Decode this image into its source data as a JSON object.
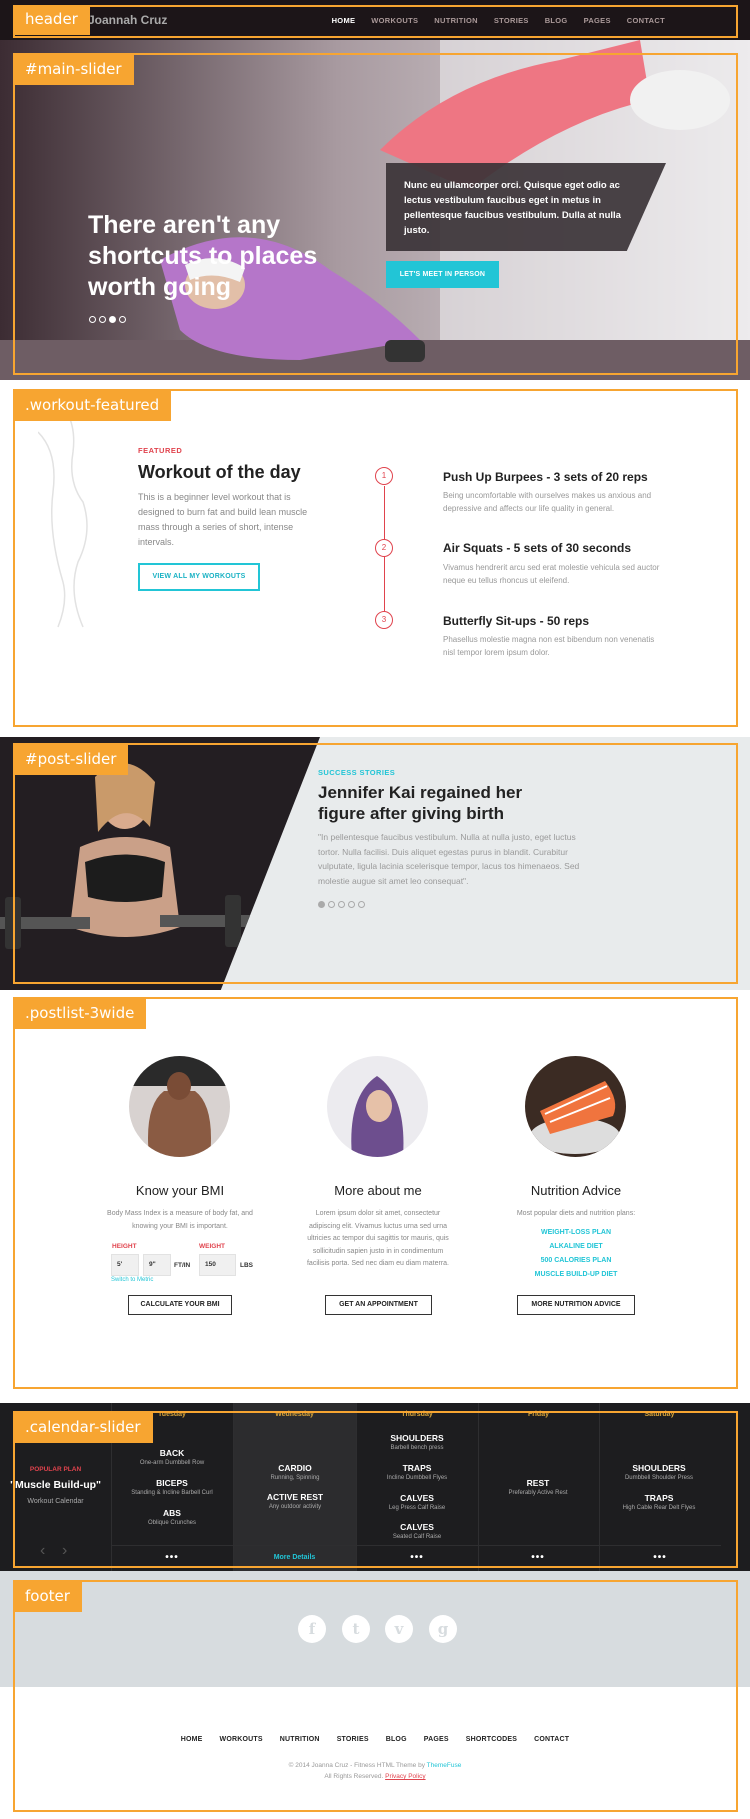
{
  "colors": {
    "accent": "#22c5d6",
    "red": "#e0434d",
    "annotation": "#f7a531",
    "dark": "#1c1518"
  },
  "annotations": {
    "header": "header",
    "main_slider": "#main-slider",
    "workout": ".workout-featured",
    "post": "#post-slider",
    "postlist": ".postlist-3wide",
    "calendar": ".calendar-slider",
    "footer": "footer"
  },
  "header": {
    "brand": "Joannah Cruz",
    "nav": [
      "HOME",
      "WORKOUTS",
      "NUTRITION",
      "STORIES",
      "BLOG",
      "PAGES",
      "CONTACT"
    ]
  },
  "hero": {
    "title": "There aren't any shortcuts to places worth going",
    "text": "Nunc eu ullamcorper orci. Quisque eget odio ac lectus vestibulum faucibus eget in metus in pellentesque faucibus vestibulum. Dulla at nulla justo.",
    "button": "LET'S MEET IN PERSON"
  },
  "workout": {
    "label": "FEATURED",
    "title": "Workout of the day",
    "desc": "This is a beginner level workout that is designed to burn fat and build lean muscle mass through a series of short, intense intervals.",
    "button": "VIEW ALL MY WORKOUTS",
    "items": [
      {
        "num": "1",
        "title": "Push Up Burpees - 3 sets of 20 reps",
        "desc": "Being uncomfortable with ourselves makes us anxious and depressive and affects our life quality in general."
      },
      {
        "num": "2",
        "title": "Air Squats - 5 sets of 30 seconds",
        "desc": "Vivamus hendrerit arcu sed erat molestie vehicula sed auctor neque eu tellus rhoncus ut eleifend."
      },
      {
        "num": "3",
        "title": "Butterfly Sit-ups - 50 reps",
        "desc": "Phasellus molestie magna non est bibendum non venenatis nisl tempor lorem ipsum dolor."
      }
    ]
  },
  "post": {
    "label": "SUCCESS STORIES",
    "title": "Jennifer Kai regained her figure after giving birth",
    "quote": "\"In pellentesque faucibus vestibulum. Nulla at nulla justo, eget luctus tortor. Nulla facilisi. Duis aliquet egestas purus in blandit. Curabitur vulputate, ligula lacinia scelerisque tempor, lacus tos himenaeos. Sed molestie augue sit amet leo consequat\"."
  },
  "postlist": {
    "bmi": {
      "title": "Know your BMI",
      "text": "Body Mass Index is a measure of body fat, and knowing your BMI is important.",
      "height_label": "HEIGHT",
      "weight_label": "WEIGHT",
      "ft": "5'",
      "in": "9\"",
      "ft_in": "FT/IN",
      "weight": "150",
      "lbs": "LBS",
      "metric": "Switch to Metric",
      "button": "CALCULATE YOUR BMI"
    },
    "more": {
      "title": "More about me",
      "text": "Lorem ipsum dolor sit amet, consectetur adipiscing elit. Vivamus luctus urna sed urna ultricies ac tempor dui sagittis tor mauris, quis sollicitudin sapien justo in in condimentum facilisis porta. Sed nec diam eu diam materra.",
      "button": "GET AN APPOINTMENT"
    },
    "nutrition": {
      "title": "Nutrition Advice",
      "text": "Most popular diets and nutrition plans:",
      "links": [
        "WEIGHT-LOSS PLAN",
        "ALKALINE DIET",
        "500 CALORIES PLAN",
        "MUSCLE BUILD-UP DIET"
      ],
      "button": "MORE NUTRITION ADVICE"
    }
  },
  "calendar": {
    "plan_label": "POPULAR PLAN",
    "plan_title": "\"Muscle Build-up\"",
    "plan_sub": "Workout Calendar",
    "days": [
      "Tuesday",
      "Wednesday",
      "Thursday",
      "Friday",
      "Saturday"
    ],
    "tue": [
      {
        "t": "BACK",
        "s": "One-arm Dumbbell Row"
      },
      {
        "t": "BICEPS",
        "s": "Standing & Incline Barbell Curl"
      },
      {
        "t": "ABS",
        "s": "Oblique Crunches"
      }
    ],
    "wed": [
      {
        "t": "CARDIO",
        "s": "Running, Spinning"
      },
      {
        "t": "ACTIVE REST",
        "s": "Any outdoor activity"
      }
    ],
    "thu": [
      {
        "t": "SHOULDERS",
        "s": "Barbell bench press"
      },
      {
        "t": "TRAPS",
        "s": "Incline Dumbbell Flyes"
      },
      {
        "t": "CALVES",
        "s": "Leg Press Calf Raise"
      },
      {
        "t": "CALVES",
        "s": "Seated Calf Raise"
      }
    ],
    "fri": [
      {
        "t": "REST",
        "s": "Preferably Active Rest"
      }
    ],
    "sat": [
      {
        "t": "SHOULDERS",
        "s": "Dumbbell Shoulder Press"
      },
      {
        "t": "TRAPS",
        "s": "High Cable Rear Delt Flyes"
      }
    ],
    "more": "•••",
    "details": "More Details"
  },
  "footer": {
    "social": [
      "f",
      "t",
      "v",
      "g"
    ],
    "nav": [
      "HOME",
      "WORKOUTS",
      "NUTRITION",
      "STORIES",
      "BLOG",
      "PAGES",
      "SHORTCODES",
      "CONTACT"
    ],
    "copy1": "© 2014 Joanna Cruz - Fitness HTML Theme by",
    "themefuse": "ThemeFuse",
    "copy2": "All Rights Reserved.",
    "privacy": "Privacy Policy"
  }
}
